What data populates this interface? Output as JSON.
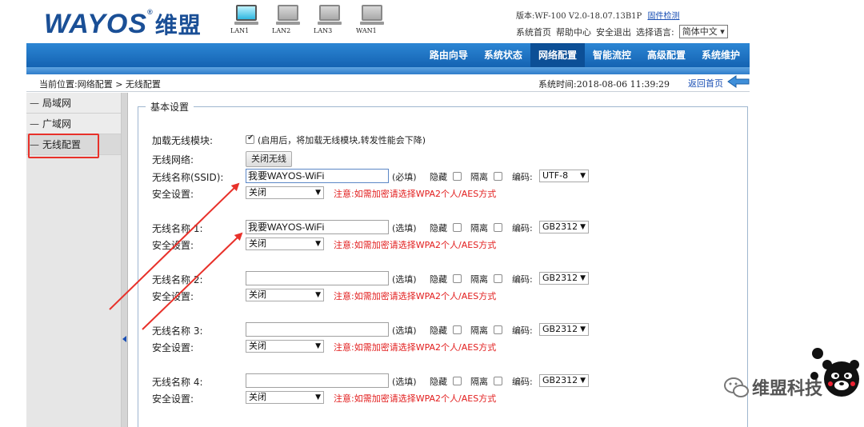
{
  "header": {
    "logo_text": "WAYOS",
    "logo_reg": "®",
    "logo_cn": "维盟",
    "ports": [
      {
        "label": "LAN1",
        "active": true
      },
      {
        "label": "LAN2",
        "active": false
      },
      {
        "label": "LAN3",
        "active": false
      },
      {
        "label": "WAN1",
        "active": false
      }
    ],
    "version_text": "版本:WF-100 V2.0-18.07.13B1P",
    "firmware_check": "固件检测",
    "links": [
      "系统首页",
      "帮助中心",
      "安全退出"
    ],
    "lang_label": "选择语言:",
    "lang_value": "简体中文"
  },
  "nav": {
    "items": [
      "路由向导",
      "系统状态",
      "网络配置",
      "智能流控",
      "高级配置",
      "系统维护"
    ],
    "active": "网络配置"
  },
  "breadcrumb": {
    "location": "当前位置:网络配置 > 无线配置",
    "system_time": "系统时间:2018-08-06 11:39:29",
    "back_label": "返回首页"
  },
  "sidebar": {
    "items": [
      "局域网",
      "广域网",
      "无线配置"
    ],
    "active": "无线配置"
  },
  "form": {
    "legend": "基本设置",
    "load_module_label": "加载无线模块:",
    "load_module_note": "(启用后，将加载无线模块,转发性能会下降)",
    "wireless_net_label": "无线网络:",
    "close_wireless_button": "关闭无线",
    "security_label": "安全设置:",
    "hidden_label": "隐藏",
    "isolate_label": "隔离",
    "encoding_label": "编码:",
    "warning": "注意:如需加密请选择WPA2个人/AES方式",
    "ssids": [
      {
        "label": "无线名称(SSID):",
        "value": "我要WAYOS-WiFi",
        "req": "(必填)",
        "encoding": "UTF-8",
        "security": "关闭"
      },
      {
        "label": "无线名称 1:",
        "value": "我要WAYOS-WiFi",
        "req": "(选填)",
        "encoding": "GB2312",
        "security": "关闭"
      },
      {
        "label": "无线名称 2:",
        "value": "",
        "req": "(选填)",
        "encoding": "GB2312",
        "security": "关闭"
      },
      {
        "label": "无线名称 3:",
        "value": "",
        "req": "(选填)",
        "encoding": "GB2312",
        "security": "关闭"
      },
      {
        "label": "无线名称 4:",
        "value": "",
        "req": "(选填)",
        "encoding": "GB2312",
        "security": "关闭"
      }
    ]
  },
  "watermark": {
    "text": "维盟科技"
  },
  "colors": {
    "nav_blue": "#1463b2",
    "annotation_red": "#e8312a",
    "warning_red": "#e21d1d",
    "link_blue": "#1a4fb4"
  }
}
